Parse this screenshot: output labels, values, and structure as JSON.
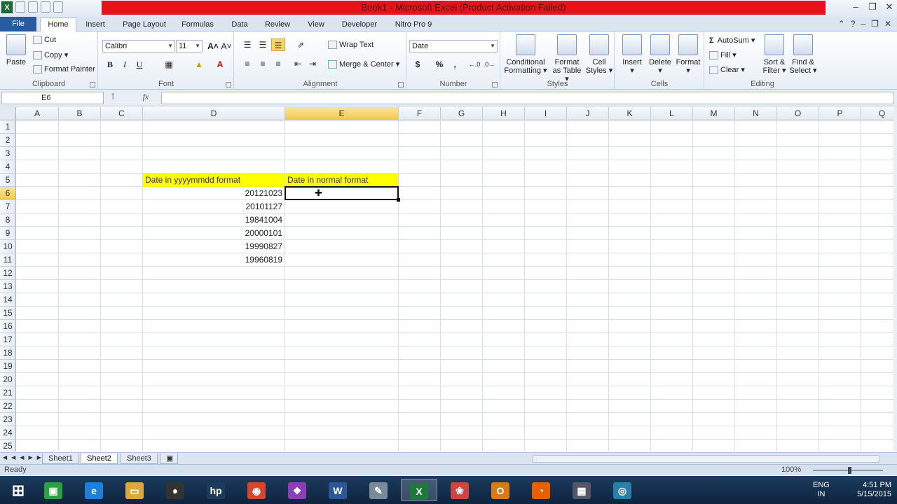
{
  "window": {
    "title": "Book1 - Microsoft Excel (Product Activation Failed)"
  },
  "tabs": [
    {
      "label": "File"
    },
    {
      "label": "Home"
    },
    {
      "label": "Insert"
    },
    {
      "label": "Page Layout"
    },
    {
      "label": "Formulas"
    },
    {
      "label": "Data"
    },
    {
      "label": "Review"
    },
    {
      "label": "View"
    },
    {
      "label": "Developer"
    },
    {
      "label": "Nitro Pro 9"
    }
  ],
  "ribbon": {
    "clipboard": {
      "name": "Clipboard",
      "paste": "Paste",
      "cut": "Cut",
      "copy": "Copy",
      "format_painter": "Format Painter"
    },
    "font": {
      "name": "Font",
      "family": "Calibri",
      "size": "11",
      "bold": "B",
      "italic": "I",
      "underline": "U"
    },
    "alignment": {
      "name": "Alignment",
      "wrap_text": "Wrap Text",
      "merge_center": "Merge & Center"
    },
    "number": {
      "name": "Number",
      "format": "Date",
      "currency": "$",
      "percent": "%",
      "comma": ","
    },
    "styles": {
      "name": "Styles",
      "conditional_1": "Conditional",
      "conditional_2": "Formatting",
      "format_table_1": "Format",
      "format_table_2": "as Table",
      "cell_styles_1": "Cell",
      "cell_styles_2": "Styles"
    },
    "cells": {
      "name": "Cells",
      "insert": "Insert",
      "delete": "Delete",
      "format": "Format"
    },
    "editing": {
      "name": "Editing",
      "autosum": "AutoSum",
      "fill": "Fill",
      "clear": "Clear",
      "sort_1": "Sort &",
      "sort_2": "Filter",
      "find_1": "Find &",
      "find_2": "Select"
    }
  },
  "formula_bar": {
    "name_box": "E6",
    "fx": "fx",
    "value": ""
  },
  "columns": [
    "A",
    "B",
    "C",
    "D",
    "E",
    "F",
    "G",
    "H",
    "I",
    "J",
    "K",
    "L",
    "M",
    "N",
    "O",
    "P",
    "Q"
  ],
  "rows": [
    "1",
    "2",
    "3",
    "4",
    "5",
    "6",
    "7",
    "8",
    "9",
    "10",
    "11",
    "12",
    "13",
    "14",
    "15",
    "16",
    "17",
    "18",
    "19",
    "20",
    "21",
    "22",
    "23",
    "24",
    "25"
  ],
  "cells": {
    "D5": "Date in yyyymmdd format",
    "E5": "Date in normal format",
    "D6": "20121023",
    "D7": "20101127",
    "D8": "19841004",
    "D9": "20000101",
    "D10": "19990827",
    "D11": "19960819"
  },
  "active_cell": "E6",
  "sheets": [
    {
      "label": "Sheet1",
      "active": false
    },
    {
      "label": "Sheet2",
      "active": true
    },
    {
      "label": "Sheet3",
      "active": false
    }
  ],
  "status": {
    "ready": "Ready",
    "zoom": "100%"
  },
  "taskbar": {
    "apps": [
      {
        "icon": "windows-start-icon"
      },
      {
        "icon": "store-icon"
      },
      {
        "icon": "internet-explorer-icon"
      },
      {
        "icon": "file-explorer-icon"
      },
      {
        "icon": "camera-icon"
      },
      {
        "icon": "hp-icon"
      },
      {
        "icon": "chrome-icon"
      },
      {
        "icon": "photos-icon"
      },
      {
        "icon": "word-icon"
      },
      {
        "icon": "notepad-icon"
      },
      {
        "icon": "excel-icon"
      },
      {
        "icon": "paint-icon"
      },
      {
        "icon": "outlook-icon"
      },
      {
        "icon": "firefox-icon"
      },
      {
        "icon": "calculator-icon"
      },
      {
        "icon": "screen-recorder-icon"
      }
    ],
    "language_1": "ENG",
    "language_2": "IN",
    "time": "4:51 PM",
    "date": "5/15/2015"
  },
  "colors": {
    "header_fill": "#ffff00",
    "title_band": "#e8121c",
    "file_tab": "#2a5b9e",
    "selection_header": "#f5c84d"
  }
}
